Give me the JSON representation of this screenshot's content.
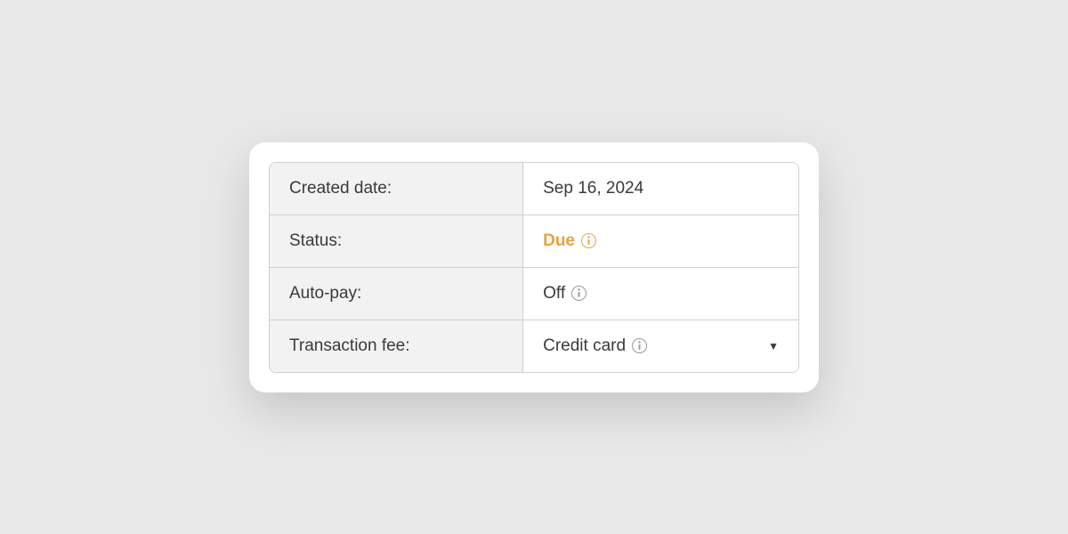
{
  "details": {
    "created_date": {
      "label": "Created date:",
      "value": "Sep 16, 2024"
    },
    "status": {
      "label": "Status:",
      "value": "Due"
    },
    "auto_pay": {
      "label": "Auto-pay:",
      "value": "Off"
    },
    "transaction_fee": {
      "label": "Transaction fee:",
      "value": "Credit card"
    }
  },
  "colors": {
    "status_due": "#e8a33d"
  }
}
